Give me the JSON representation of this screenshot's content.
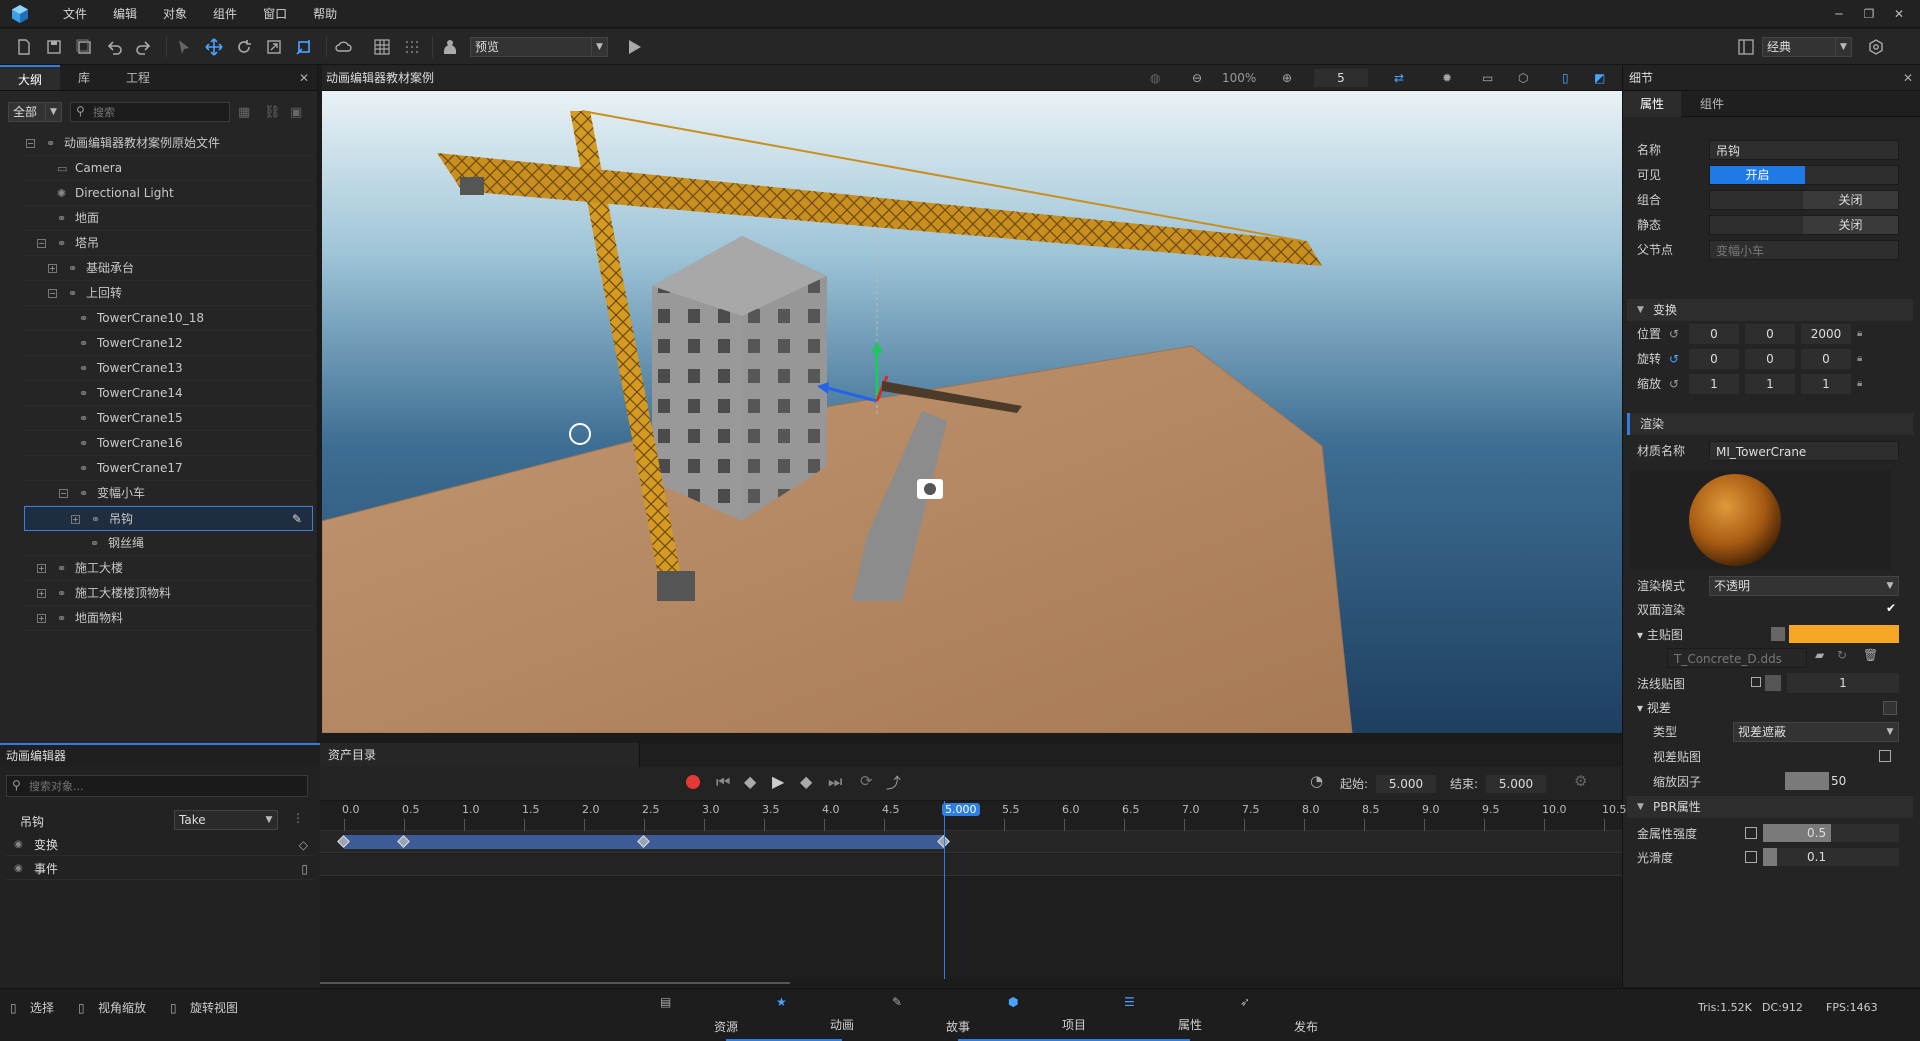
{
  "menu": {
    "items": [
      "文件",
      "编辑",
      "对象",
      "组件",
      "窗口",
      "帮助"
    ]
  },
  "toolbar": {
    "preview_select": "预览",
    "layout_select": "经典"
  },
  "left": {
    "tabs": [
      "大纲",
      "库",
      "工程"
    ],
    "filter": "全部",
    "search_placeholder": "搜索"
  },
  "tree": [
    {
      "label": "动画编辑器教材案例原始文件",
      "level": 0,
      "tog": "−"
    },
    {
      "label": "Camera",
      "level": 1,
      "icon": "camera"
    },
    {
      "label": "Directional Light",
      "level": 1,
      "icon": "light"
    },
    {
      "label": "地面",
      "level": 1
    },
    {
      "label": "塔吊",
      "level": 1,
      "tog": "−"
    },
    {
      "label": "基础承台",
      "level": 2,
      "tog": "+"
    },
    {
      "label": "上回转",
      "level": 2,
      "tog": "−"
    },
    {
      "label": "TowerCrane10_18",
      "level": 3
    },
    {
      "label": "TowerCrane12",
      "level": 3
    },
    {
      "label": "TowerCrane13",
      "level": 3
    },
    {
      "label": "TowerCrane14",
      "level": 3
    },
    {
      "label": "TowerCrane15",
      "level": 3
    },
    {
      "label": "TowerCrane16",
      "level": 3
    },
    {
      "label": "TowerCrane17",
      "level": 3
    },
    {
      "label": "变幅小车",
      "level": 3,
      "tog": "−"
    },
    {
      "label": "吊钩",
      "level": 4,
      "tog": "+",
      "selected": true
    },
    {
      "label": "钢丝绳",
      "level": 4
    },
    {
      "label": "施工大楼",
      "level": 1,
      "tog": "+"
    },
    {
      "label": "施工大楼楼顶物料",
      "level": 1,
      "tog": "+"
    },
    {
      "label": "地面物料",
      "level": 1,
      "tog": "+"
    }
  ],
  "viewport": {
    "title": "动画编辑器教材案例",
    "zoom": "100%",
    "speed": "5"
  },
  "details": {
    "header": "细节",
    "tabs": [
      "属性",
      "组件"
    ],
    "name_label": "名称",
    "name_value": "吊钩",
    "visible_label": "可见",
    "visible_value": "开启",
    "group_label": "组合",
    "group_value": "关闭",
    "static_label": "静态",
    "static_value": "关闭",
    "parent_label": "父节点",
    "parent_value": "变幅小车",
    "transform_section": "变换",
    "position_label": "位置",
    "position": [
      "0",
      "0",
      "2000"
    ],
    "rotation_label": "旋转",
    "rotation": [
      "0",
      "0",
      "0"
    ],
    "scale_label": "缩放",
    "scale": [
      "1",
      "1",
      "1"
    ],
    "render_section": "渲染",
    "material_label": "材质名称",
    "material_value": "MI_TowerCrane",
    "render_mode_label": "渲染模式",
    "render_mode_value": "不透明",
    "double_side_label": "双面渲染",
    "main_tex_label": "主贴图",
    "main_tex_file": "T_Concrete_D.dds",
    "main_tex_color": "#f5a623",
    "normal_label": "法线贴图",
    "normal_value": "1",
    "parallax_label": "视差",
    "type_label": "类型",
    "type_value": "视差遮蔽",
    "parallax_tex_label": "视差贴图",
    "scale_factor_label": "缩放因子",
    "scale_factor_value": "50",
    "pbr_section": "PBR属性",
    "metal_label": "金属性强度",
    "metal_value": "0.5",
    "smooth_label": "光滑度",
    "smooth_value": "0.1"
  },
  "anim": {
    "title": "动画编辑器",
    "search_placeholder": "搜索对象...",
    "target": "吊钩",
    "take": "Take",
    "tracks": [
      "变换",
      "事件"
    ]
  },
  "timeline": {
    "tab": "资产目录",
    "start_label": "起始:",
    "start": "5.000",
    "end_label": "结束:",
    "end": "5.000",
    "ticks": [
      "0.0",
      "0.5",
      "1.0",
      "1.5",
      "2.0",
      "2.5",
      "3.0",
      "3.5",
      "4.0",
      "4.5",
      "5.000",
      "5.5",
      "6.0",
      "6.5",
      "7.0",
      "7.5",
      "8.0",
      "8.5",
      "9.0",
      "9.5",
      "10.0",
      "10.5"
    ],
    "keyframes": [
      0.0,
      0.5,
      2.5,
      5.0
    ],
    "playhead": 5.0
  },
  "status": {
    "left": [
      "选择",
      "视角缩放",
      "旋转视图"
    ],
    "tabs": [
      "资源",
      "动画",
      "故事",
      "项目",
      "属性",
      "发布"
    ],
    "active_tab": "动画",
    "tris": "Tris:1.52K",
    "dc": "DC:912",
    "fps": "FPS:1463"
  }
}
